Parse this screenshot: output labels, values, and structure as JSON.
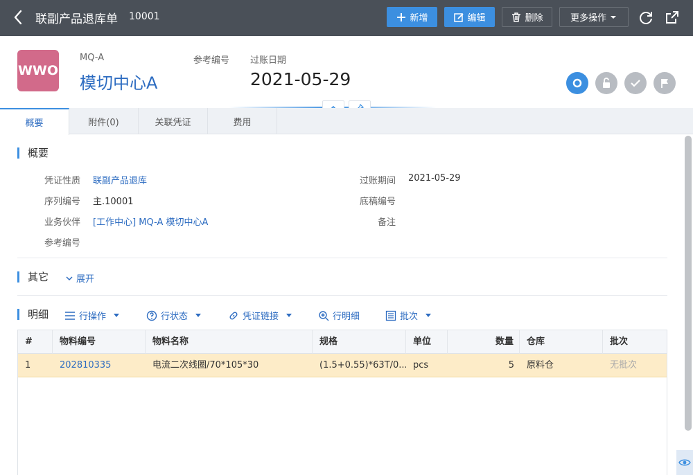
{
  "header": {
    "title": "联副产品退库单",
    "doc_id": "10001",
    "buttons": {
      "add": "新增",
      "edit": "编辑",
      "delete": "删除",
      "more": "更多操作"
    }
  },
  "summary": {
    "logo_text": "WWO",
    "code": "MQ-A",
    "name": "模切中心A",
    "ref_label": "参考编号",
    "date_label": "过账日期",
    "date_value": "2021-05-29"
  },
  "tabs": [
    "概要",
    "附件(0)",
    "关联凭证",
    "费用"
  ],
  "overview": {
    "title": "概要",
    "fields": {
      "nature_label": "凭证性质",
      "nature_value": "联副产品退库",
      "serial_label": "序列编号",
      "serial_value": "主.10001",
      "partner_label": "业务伙伴",
      "partner_value": "[工作中心] MQ-A 模切中心A",
      "ref_label": "参考编号",
      "period_label": "过账期间",
      "period_value": "2021-05-29",
      "draft_label": "底稿编号",
      "remark_label": "备注"
    }
  },
  "other": {
    "title": "其它",
    "expand": "展开"
  },
  "detail": {
    "title": "明细",
    "tools": {
      "row_ops": "行操作",
      "row_status": "行状态",
      "voucher_link": "凭证链接",
      "row_detail": "行明细",
      "batch": "批次"
    },
    "columns": [
      "#",
      "物料编号",
      "物料名称",
      "规格",
      "单位",
      "数量",
      "仓库",
      "批次"
    ],
    "rows": [
      {
        "index": "1",
        "code": "202810335",
        "name": "电流二次线圈/70*105*30",
        "spec": "(1.5+0.55)*63T/0....",
        "unit": "pcs",
        "qty": "5",
        "warehouse": "原料仓",
        "batch": "无批次"
      }
    ]
  },
  "colors": {
    "accent": "#3c8fe0",
    "topbar": "#4a5058",
    "logo": "#d26a8a",
    "row_highlight": "#fdecc8"
  }
}
